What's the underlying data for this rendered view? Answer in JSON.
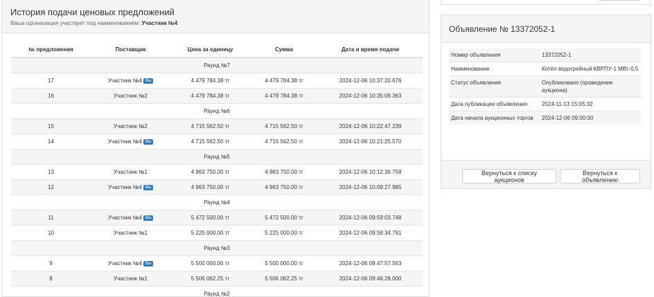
{
  "history": {
    "title": "История подачи ценовых предложений",
    "subtitle_prefix": "Ваша организация участвует под наименованием:",
    "subtitle_name": "Участник №4",
    "columns": [
      "№ предложения",
      "Поставщик",
      "Цена за единицу",
      "Сумма",
      "Дата и время подачи"
    ],
    "you_badge": "Вы",
    "rows": [
      {
        "round": "Раунд №7"
      },
      {
        "num": "17",
        "supplier": "Участник №4",
        "you": true,
        "price": "4 479 784.38 тг",
        "sum": "4 479 784.38 тг",
        "date": "2024-12-06 10:37:20.676"
      },
      {
        "num": "16",
        "supplier": "Участник №2",
        "you": false,
        "price": "4 479 784.38 тг",
        "sum": "4 479 784.38 тг",
        "date": "2024-12-06 10:35:09.363"
      },
      {
        "round": "Раунд №6"
      },
      {
        "num": "15",
        "supplier": "Участник №2",
        "you": false,
        "price": "4 715 562.50 тг",
        "sum": "4 715 562.50 тг",
        "date": "2024-12-06 10:22:47.239"
      },
      {
        "num": "14",
        "supplier": "Участник №4",
        "you": true,
        "price": "4 715 562.50 тг",
        "sum": "4 715 562.50 тг",
        "date": "2024-12-06 10:21:25.570"
      },
      {
        "round": "Раунд №5"
      },
      {
        "num": "13",
        "supplier": "Участник №1",
        "you": false,
        "price": "4 963 750.00 тг",
        "sum": "4 963 750.00 тг",
        "date": "2024-12-06 10:12:38.758"
      },
      {
        "num": "12",
        "supplier": "Участник №4",
        "you": true,
        "price": "4 963 750.00 тг",
        "sum": "4 963 750.00 тг",
        "date": "2024-12-06 10:09:27.985"
      },
      {
        "round": "Раунд №4"
      },
      {
        "num": "11",
        "supplier": "Участник №4",
        "you": true,
        "price": "5 472 500.00 тг",
        "sum": "5 472 500.00 тг",
        "date": "2024-12-06 09:59:03.748"
      },
      {
        "num": "10",
        "supplier": "Участник №1",
        "you": false,
        "price": "5 225 000.00 тг",
        "sum": "5 225 000.00 тг",
        "date": "2024-12-06 09:58:34.791"
      },
      {
        "round": "Раунд №3"
      },
      {
        "num": "9",
        "supplier": "Участник №4",
        "you": true,
        "price": "5 500 000.00 тг",
        "sum": "5 500 000.00 тг",
        "date": "2024-12-06 09:47:57.563"
      },
      {
        "num": "8",
        "supplier": "Участник №1",
        "you": false,
        "price": "5 506 062.25 тг",
        "sum": "5 506 062.25 тг",
        "date": "2024-12-06 09:46:28.000"
      },
      {
        "round": "Раунд №2"
      }
    ]
  },
  "announcement": {
    "title": "Объявление № 13372052-1",
    "fields": [
      {
        "label": "Номер объявления",
        "value": "13372052-1"
      },
      {
        "label": "Наименование",
        "value": "Котёл водогрейный КВРПУ-1 МВт-0,5"
      },
      {
        "label": "Статус объявления",
        "value": "Опубликовано (проведение аукциона)"
      },
      {
        "label": "Дата публикации объявления",
        "value": "2024-11-13 15:05:32"
      },
      {
        "label": "Дата начала аукционных торгов",
        "value": "2024-12-06 09:00:00"
      }
    ],
    "back_to_list_label": "Вернуться к списку аукционов",
    "back_to_announcement_label": "Вернуться к объявлению"
  }
}
